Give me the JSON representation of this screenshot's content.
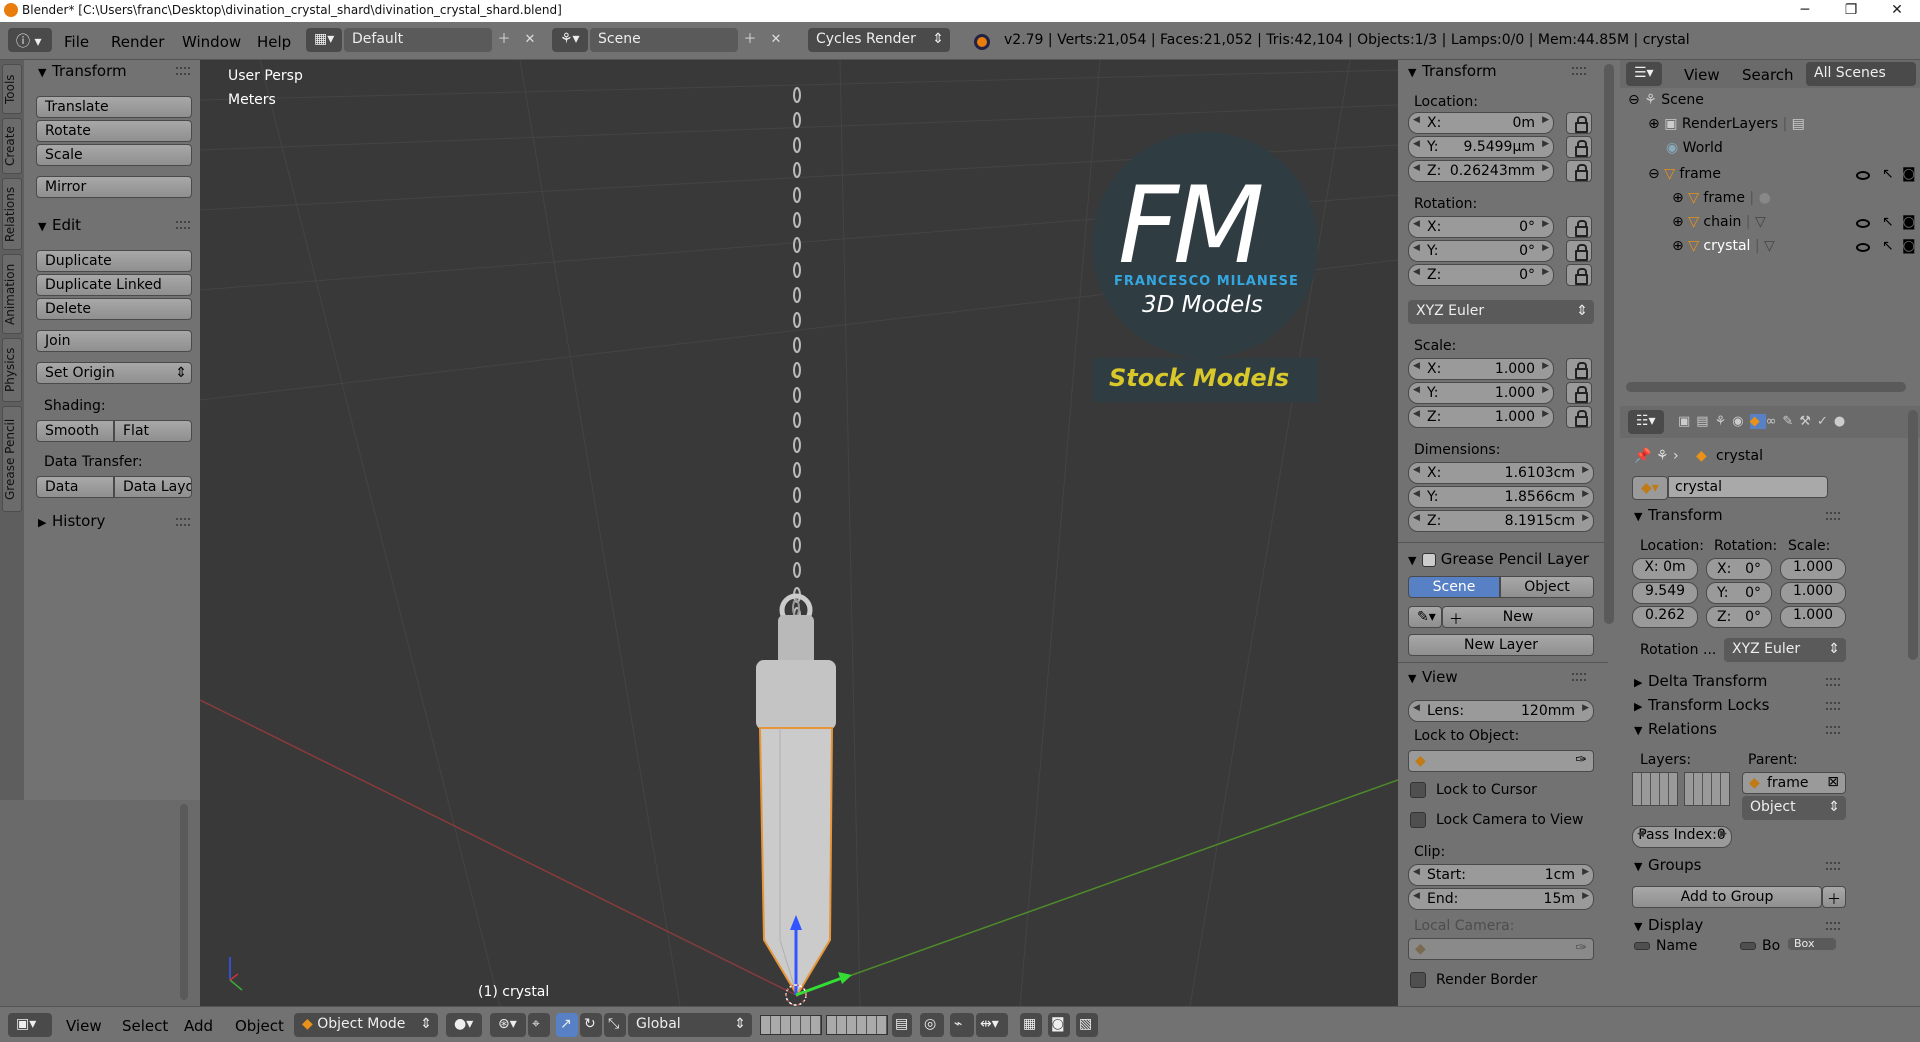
{
  "titlebar": {
    "title": "Blender* [C:\\Users\\franc\\Desktop\\divination_crystal_shard\\divination_crystal_shard.blend]",
    "minimize": "─",
    "maximize": "❐",
    "close": "✕"
  },
  "topmenu": {
    "info_icon": "info-icon",
    "file": "File",
    "render": "Render",
    "window": "Window",
    "help": "Help",
    "layout": "Default",
    "scene": "Scene",
    "engine": "Cycles Render",
    "stats": "v2.79 | Verts:21,054 | Faces:21,052 | Tris:42,104 | Objects:1/3 | Lamps:0/0 | Mem:44.85M | crystal"
  },
  "tool_tabs": [
    "Tools",
    "Create",
    "Relations",
    "Animation",
    "Physics",
    "Grease Pencil"
  ],
  "toolshelf": {
    "transform_header": "Transform",
    "translate": "Translate",
    "rotate": "Rotate",
    "scale": "Scale",
    "mirror": "Mirror",
    "edit_header": "Edit",
    "duplicate": "Duplicate",
    "duplicate_linked": "Duplicate Linked",
    "delete": "Delete",
    "join": "Join",
    "set_origin": "Set Origin",
    "shading_label": "Shading:",
    "smooth": "Smooth",
    "flat": "Flat",
    "data_transfer_label": "Data Transfer:",
    "data": "Data",
    "data_layo": "Data Layo",
    "history_header": "History"
  },
  "viewport": {
    "view_name": "User Persp",
    "units": "Meters",
    "object_label": "(1) crystal",
    "logo_initials": "FM",
    "logo_name": "FRANCESCO MILANESE",
    "logo_sub": "3D Models",
    "stock": "Stock Models"
  },
  "npanel": {
    "transform_header": "Transform",
    "location_label": "Location:",
    "loc": [
      {
        "k": "X:",
        "v": "0m"
      },
      {
        "k": "Y:",
        "v": "9.5499µm"
      },
      {
        "k": "Z:",
        "v": "0.26243mm"
      }
    ],
    "rotation_label": "Rotation:",
    "rot": [
      {
        "k": "X:",
        "v": "0°"
      },
      {
        "k": "Y:",
        "v": "0°"
      },
      {
        "k": "Z:",
        "v": "0°"
      }
    ],
    "rot_mode": "XYZ Euler",
    "scale_label": "Scale:",
    "scl": [
      {
        "k": "X:",
        "v": "1.000"
      },
      {
        "k": "Y:",
        "v": "1.000"
      },
      {
        "k": "Z:",
        "v": "1.000"
      }
    ],
    "dimensions_label": "Dimensions:",
    "dim": [
      {
        "k": "X:",
        "v": "1.6103cm"
      },
      {
        "k": "Y:",
        "v": "1.8566cm"
      },
      {
        "k": "Z:",
        "v": "8.1915cm"
      }
    ],
    "gp_header": "Grease Pencil Layer",
    "gp_scene": "Scene",
    "gp_object": "Object",
    "gp_new": "New",
    "gp_new_layer": "New Layer",
    "view_header": "View",
    "lens_k": "Lens:",
    "lens_v": "120mm",
    "lock_to_object": "Lock to Object:",
    "lock_cursor": "Lock to Cursor",
    "lock_camera": "Lock Camera to View",
    "clip_label": "Clip:",
    "start_k": "Start:",
    "start_v": "1cm",
    "end_k": "End:",
    "end_v": "15m",
    "local_camera": "Local Camera:",
    "render_border": "Render Border"
  },
  "outliner": {
    "view": "View",
    "search": "Search",
    "all_scenes": "All Scenes",
    "items": [
      "Scene",
      "RenderLayers",
      "World",
      "frame",
      "frame",
      "chain",
      "crystal"
    ]
  },
  "props": {
    "breadcrumb": "crystal",
    "name": "crystal",
    "transform_header": "Transform",
    "location_label": "Location:",
    "rotation_label": "Rotation:",
    "scale_label": "Scale:",
    "loc": [
      "X: 0m",
      "9.549",
      "0.262"
    ],
    "rot": [
      {
        "k": "X:",
        "v": "0°"
      },
      {
        "k": "Y:",
        "v": "0°"
      },
      {
        "k": "Z:",
        "v": "0°"
      }
    ],
    "scl": [
      "1.000",
      "1.000",
      "1.000"
    ],
    "rotation_mode_label": "Rotation ...",
    "rotation_mode": "XYZ Euler",
    "delta_transform": "Delta Transform",
    "transform_locks": "Transform Locks",
    "relations": "Relations",
    "layers_label": "Layers:",
    "parent_label": "Parent:",
    "parent_value": "frame",
    "parent_type": "Object",
    "pass_index": "Pass Index:0",
    "groups": "Groups",
    "add_to_group": "Add to Group",
    "display": "Display",
    "name_label": "Name",
    "bo_label": "Bo",
    "box_label": "Box"
  },
  "statusbar": {
    "view": "View",
    "select": "Select",
    "add": "Add",
    "object": "Object",
    "mode": "Object Mode",
    "orientation": "Global"
  }
}
